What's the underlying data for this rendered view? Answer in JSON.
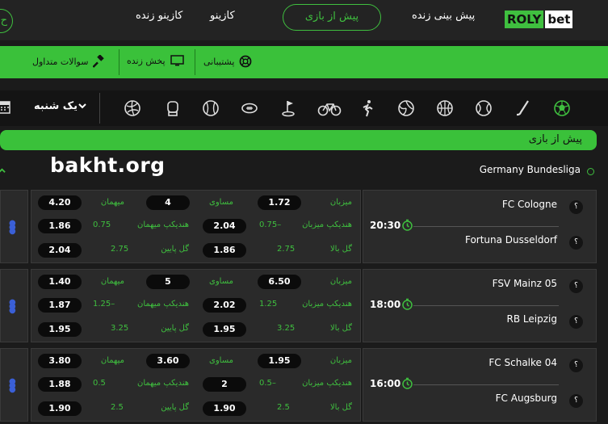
{
  "nav": {
    "live_casino": "کازینو زنده",
    "casino": "کازینو",
    "pregame": "پیش از بازی",
    "prediction": "پیش بینی زنده",
    "logo_left": "ROLY",
    "logo_right": "bet",
    "edge": "ح"
  },
  "greenbar": {
    "faq": "سوالات متداول",
    "live_stream": "پخش زنده",
    "support": "پشتیبانی"
  },
  "sports": {
    "day": "یک شنبه",
    "icons": [
      "volleyball-icon",
      "glove-icon",
      "baseball-icon",
      "football-icon",
      "golf-icon",
      "cycling-icon",
      "athletics-icon",
      "volleyball2-icon",
      "basketball-icon",
      "tennis-icon",
      "hockey-icon",
      "soccer-icon"
    ]
  },
  "section_title": "پیش از بازی",
  "watermark": "bakht.org",
  "league": "Germany Bundesliga",
  "labels": {
    "home": "میزبان",
    "draw": "مساوی",
    "away": "میهمان",
    "hc_home": "هندیکپ میزبان",
    "hc_away": "هندیکپ میهمان",
    "over": "گل بالا",
    "under": "گل پایین"
  },
  "matches": [
    {
      "home": "FC Cologne",
      "away": "Fortuna Dusseldorf",
      "time": "20:30",
      "home_odd": "1.72",
      "draw_odd": "4",
      "away_odd": "4.20",
      "hc_home_line": "0.75–",
      "hc_home_odd": "2.04",
      "hc_away_line": "0.75",
      "hc_away_odd": "1.86",
      "over_line": "2.75",
      "over_odd": "1.86",
      "under_line": "2.75",
      "under_odd": "2.04"
    },
    {
      "home": "FSV Mainz 05",
      "away": "RB Leipzig",
      "time": "18:00",
      "home_odd": "6.50",
      "draw_odd": "5",
      "away_odd": "1.40",
      "hc_home_line": "1.25",
      "hc_home_odd": "2.02",
      "hc_away_line": "1.25–",
      "hc_away_odd": "1.87",
      "over_line": "3.25",
      "over_odd": "1.95",
      "under_line": "3.25",
      "under_odd": "1.95"
    },
    {
      "home": "FC Schalke 04",
      "away": "FC Augsburg",
      "time": "16:00",
      "home_odd": "1.95",
      "draw_odd": "3.60",
      "away_odd": "3.80",
      "hc_home_line": "0.5–",
      "hc_home_odd": "2",
      "hc_away_line": "0.5",
      "hc_away_odd": "1.88",
      "over_line": "2.5",
      "over_odd": "1.90",
      "under_line": "2.5",
      "under_odd": "1.90"
    }
  ]
}
